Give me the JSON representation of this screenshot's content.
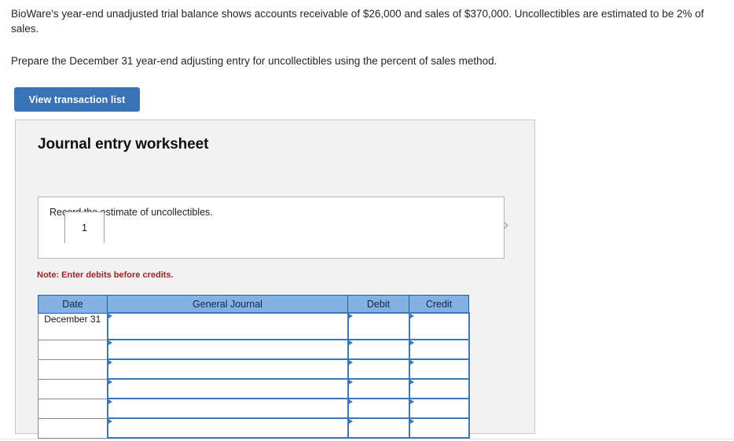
{
  "problem": {
    "paragraph_1": "BioWare's year-end unadjusted trial balance shows accounts receivable of $26,000 and sales of $370,000. Uncollectibles are estimated to be 2% of sales.",
    "paragraph_2": "Prepare the December 31 year-end adjusting entry for uncollectibles using the percent of sales method."
  },
  "toolbar": {
    "view_transaction_list_label": "View transaction list",
    "button_color": "#3a72b8"
  },
  "worksheet": {
    "title": "Journal entry worksheet",
    "prev_arrow": "‹",
    "next_arrow": "›",
    "tabs": [
      {
        "label": "1",
        "active": true
      }
    ],
    "description": "Record the estimate of uncollectibles.",
    "note": "Note: Enter debits before credits.",
    "note_color": "#a42323",
    "header_color": "#82b1e3",
    "cell_border_color": "#3d77b5"
  },
  "journal_table": {
    "columns": [
      "Date",
      "General Journal",
      "Debit",
      "Credit"
    ],
    "rows": [
      {
        "date": "December 31",
        "general_journal": "",
        "debit": "",
        "credit": ""
      },
      {
        "date": "",
        "general_journal": "",
        "debit": "",
        "credit": ""
      },
      {
        "date": "",
        "general_journal": "",
        "debit": "",
        "credit": ""
      },
      {
        "date": "",
        "general_journal": "",
        "debit": "",
        "credit": ""
      },
      {
        "date": "",
        "general_journal": "",
        "debit": "",
        "credit": ""
      },
      {
        "date": "",
        "general_journal": "",
        "debit": "",
        "credit": ""
      }
    ]
  }
}
